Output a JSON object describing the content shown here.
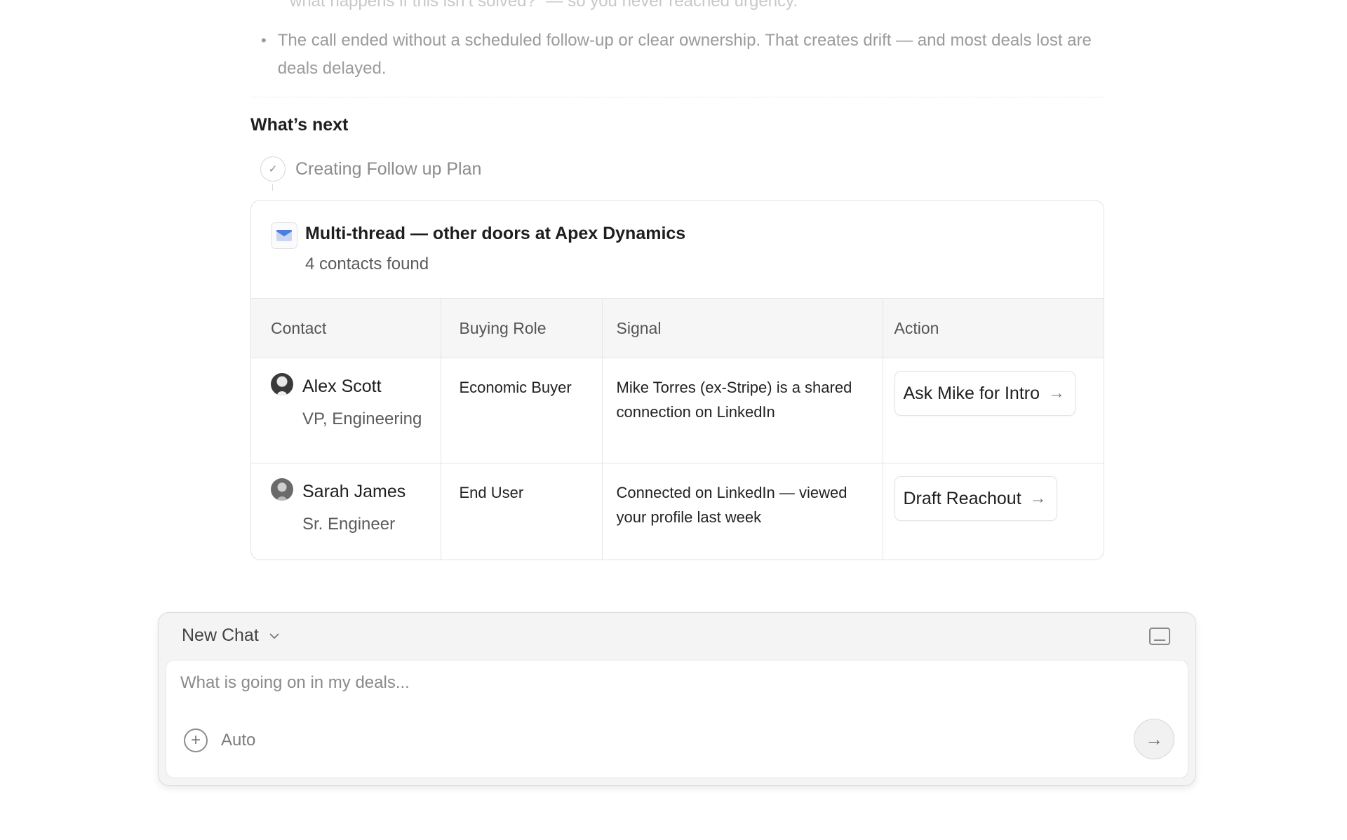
{
  "summary": {
    "faded_line": "“what happens if this isn’t solved?” — so you never reached urgency.",
    "bullet": "The call ended without a scheduled follow-up or clear ownership. That creates drift — and most deals lost are deals delayed."
  },
  "whats_next": {
    "title": "What’s next",
    "step_label": "Creating Follow up Plan"
  },
  "card": {
    "icon": "mail-icon",
    "title": "Multi-thread — other doors at Apex Dynamics",
    "subtitle": "4 contacts found",
    "columns": [
      "Contact",
      "Buying Role",
      "Signal",
      "Action"
    ],
    "rows": [
      {
        "name": "Alex Scott",
        "title": "VP, Engineering",
        "role": "Economic Buyer",
        "signal": "Mike Torres (ex-Stripe) is a shared connection on LinkedIn",
        "action": "Ask Mike for Intro"
      },
      {
        "name": "Sarah James",
        "title": "Sr. Engineer",
        "role": "End User",
        "signal": "Connected on LinkedIn — viewed your profile last week",
        "action": "Draft Reachout"
      }
    ]
  },
  "composer": {
    "chat_name": "New Chat",
    "placeholder": "What is going on in my deals...",
    "mode": "Auto",
    "icons": [
      "chevron-down-icon",
      "panel-icon",
      "plus-icon",
      "send-arrow-icon"
    ]
  },
  "colors": {
    "accent_blue": "#4a7fe0",
    "muted_text": "#9b9b9b",
    "border": "#e3e3e3"
  }
}
